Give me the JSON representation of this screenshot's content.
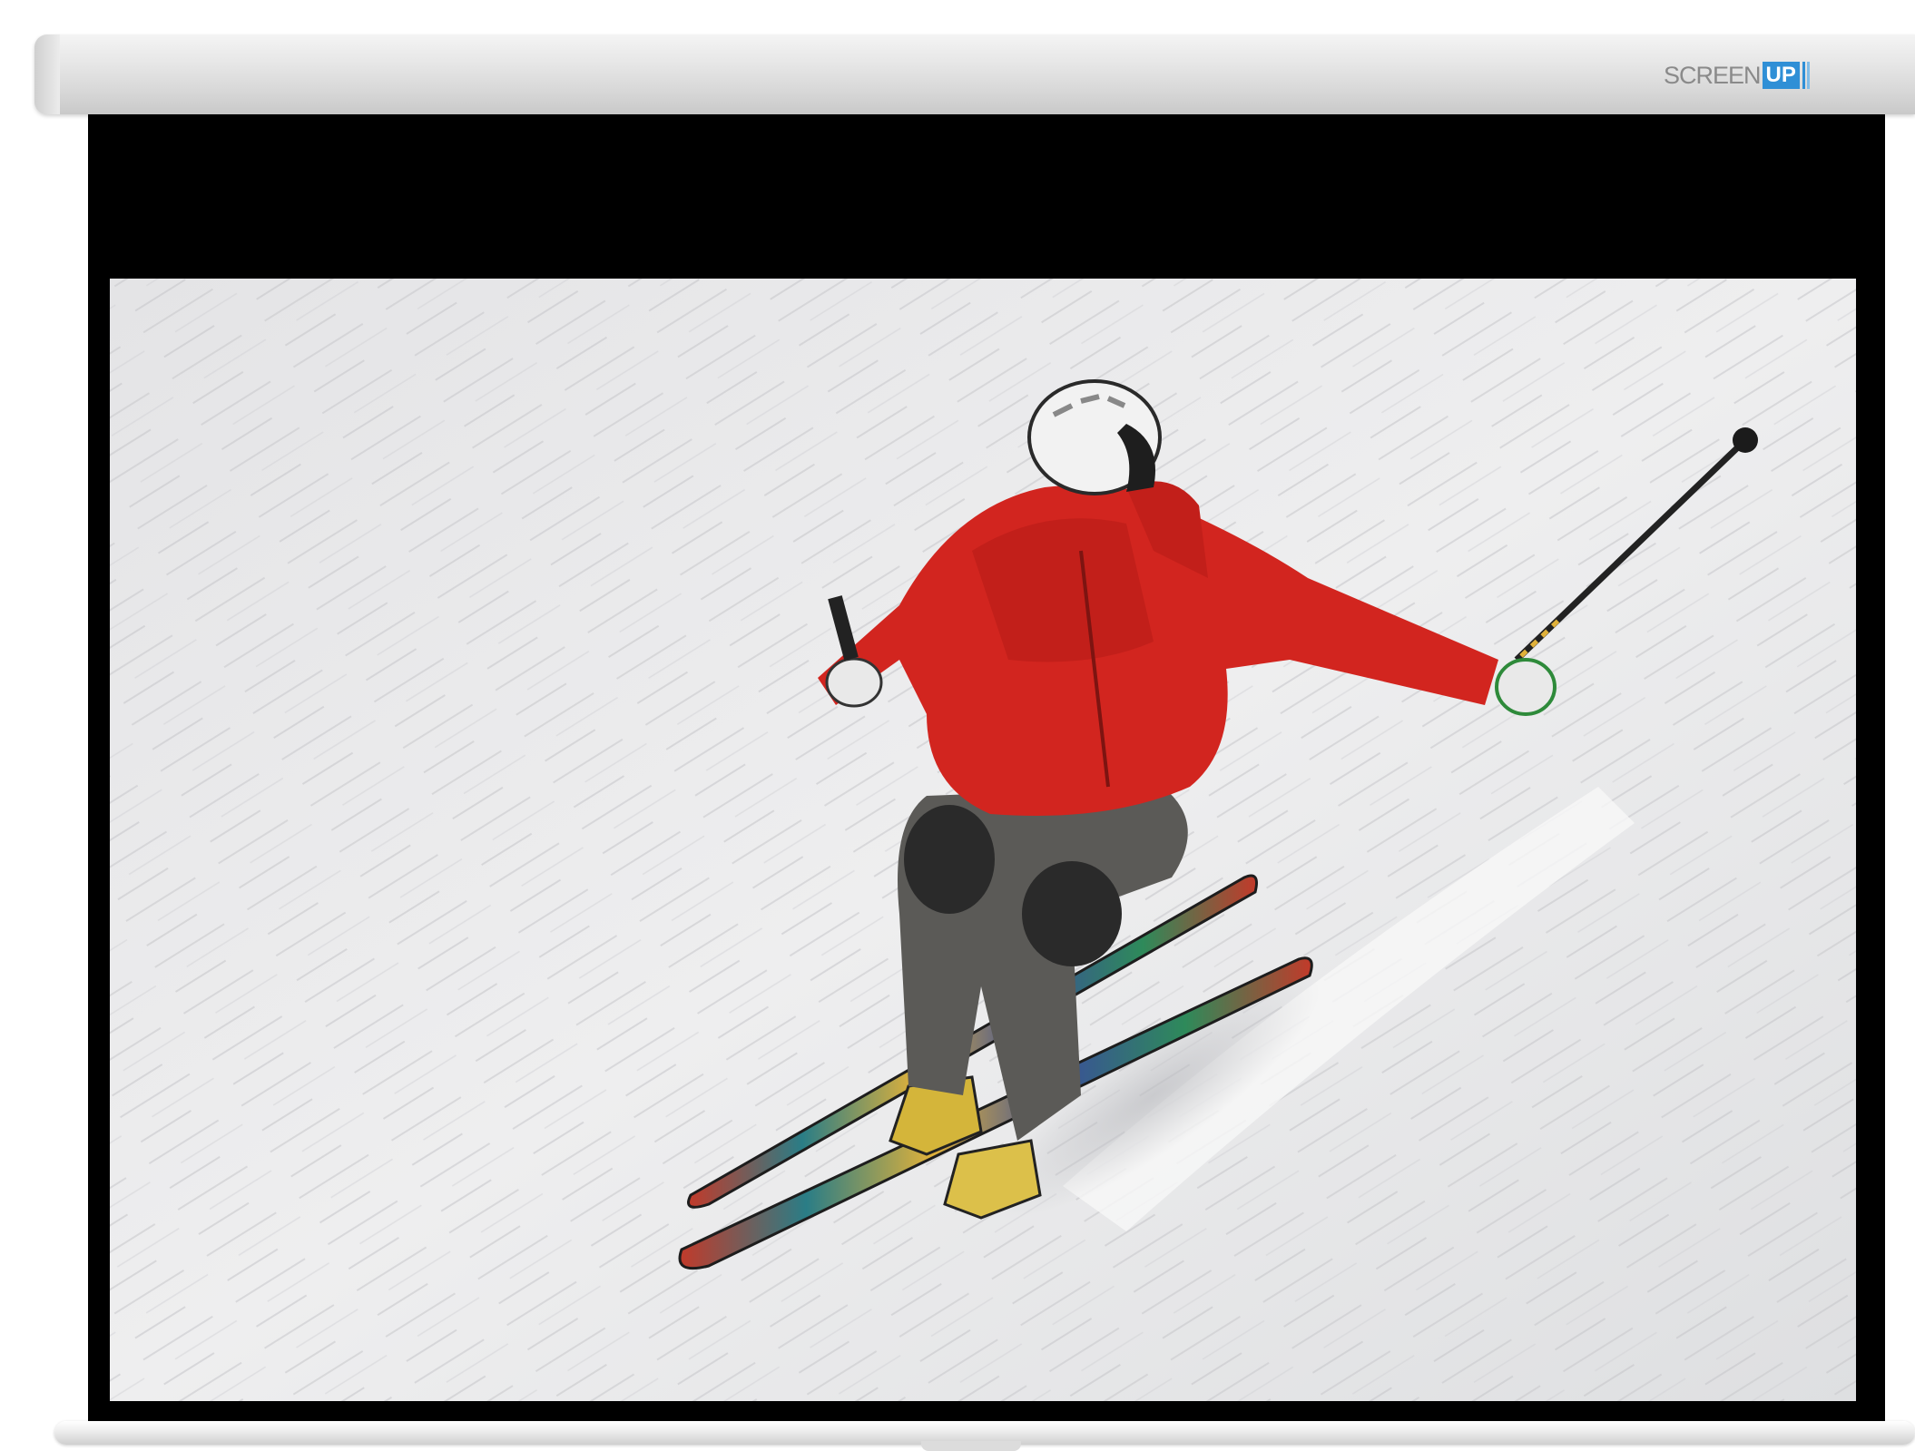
{
  "brand": {
    "word": "SCREEN",
    "mark": "UP",
    "accent_color": "#2f8fd6"
  },
  "projected_image": {
    "scene": "skier",
    "jacket_color": "#d2251f",
    "snow_color": "#e9e9eb"
  }
}
